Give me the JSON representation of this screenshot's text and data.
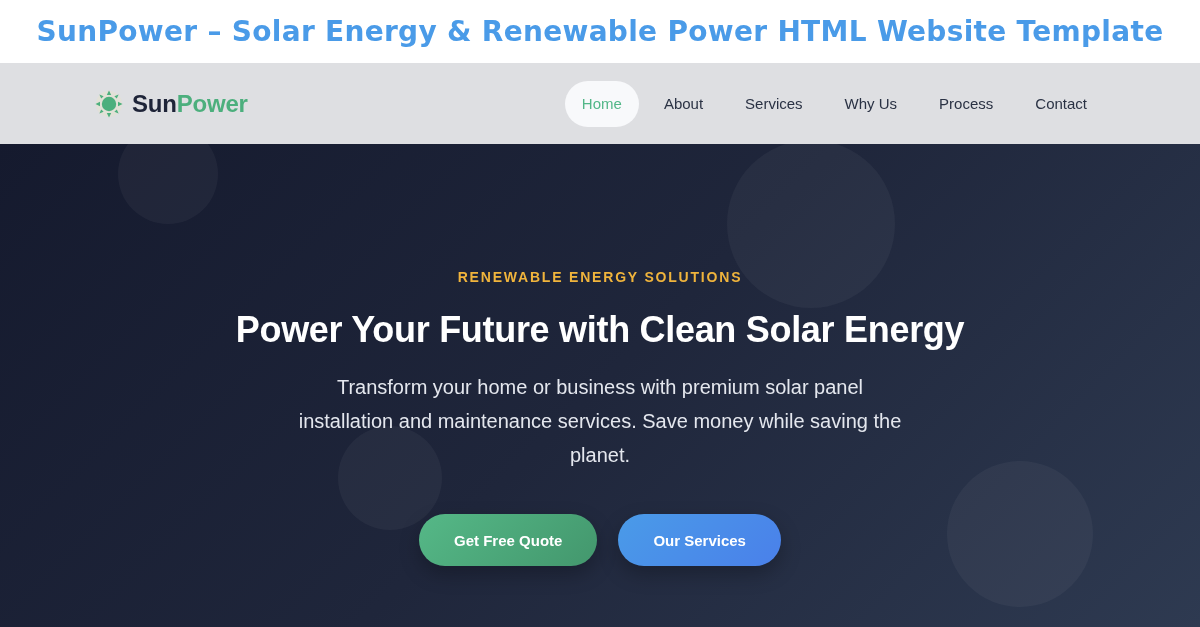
{
  "page_title": "SunPower – Solar Energy & Renewable Power HTML Website Template",
  "navbar": {
    "logo": {
      "name_primary": "Sun",
      "name_accent": "Power"
    },
    "links": [
      {
        "label": "Home",
        "selected": true
      },
      {
        "label": "About",
        "selected": false
      },
      {
        "label": "Services",
        "selected": false
      },
      {
        "label": "Why Us",
        "selected": false
      },
      {
        "label": "Process",
        "selected": false
      },
      {
        "label": "Contact",
        "selected": false
      }
    ]
  },
  "hero": {
    "eyebrow": "RENEWABLE ENERGY SOLUTIONS",
    "heading": "Power Your Future with Clean Solar Energy",
    "description": "Transform your home or business with premium solar panel installation and maintenance services. Save money while saving the planet.",
    "buttons": [
      {
        "label": "Get Free Quote",
        "kind": "primary"
      },
      {
        "label": "Our Services",
        "kind": "secondary"
      }
    ]
  }
}
